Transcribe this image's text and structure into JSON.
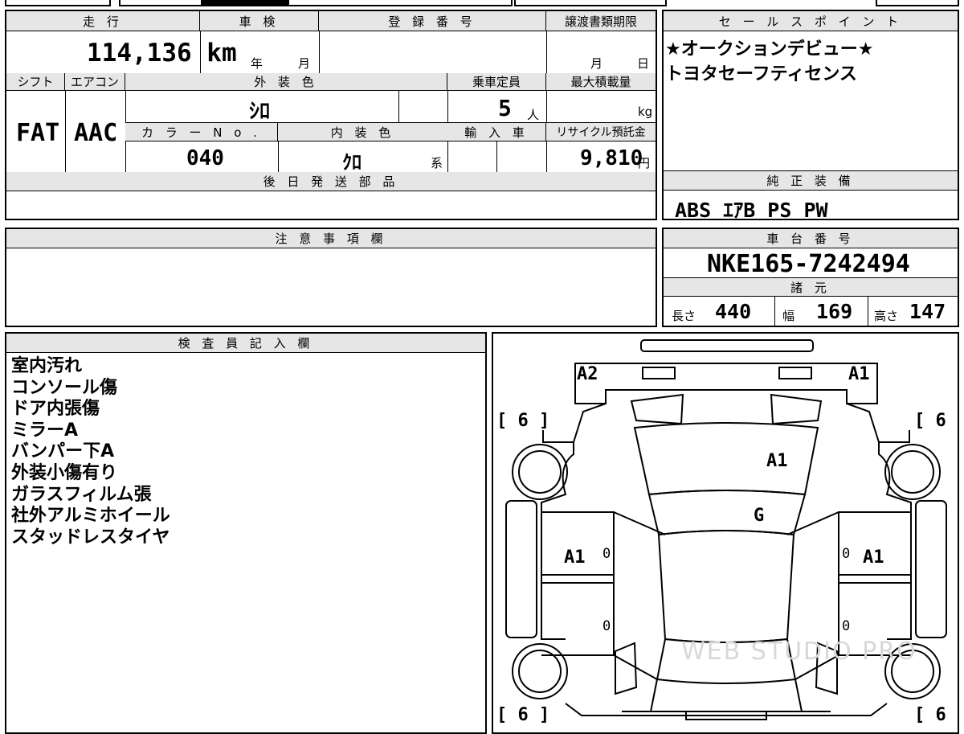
{
  "labels": {
    "mileage": "走 行",
    "inspection": "車 検",
    "registration": "登 録 番 号",
    "transfer_deadline": "譲渡書類期限",
    "sales_point": "セ ー ル ス ポ イ ン ト",
    "shift": "シフト",
    "aircon": "エアコン",
    "exterior_color": "外 装 色",
    "capacity": "乗車定員",
    "max_load": "最大積載量",
    "color_no": "カ ラ ー N o .",
    "interior_color": "内 装 色",
    "import": "輸 入 車",
    "recycle_fee": "リサイクル預託金",
    "later_parts": "後 日 発 送 部 品",
    "standard_equipment": "純 正 装 備",
    "notes": "注 意 事 項 欄",
    "chassis_number": "車 台 番 号",
    "specs": "諸 元",
    "length": "長さ",
    "width": "幅",
    "height": "高さ",
    "inspector_notes": "検 査 員 記 入 欄"
  },
  "units": {
    "year": "年",
    "month": "月",
    "day": "日",
    "person": "人",
    "kg": "kg",
    "yen": "円",
    "interior_suffix": "系"
  },
  "values": {
    "mileage": "114,136 km",
    "shift": "FAT",
    "aircon": "AAC",
    "exterior_color": "ｼﾛ",
    "capacity": "5",
    "color_no": "040",
    "interior_color": "ｸﾛ",
    "recycle_fee": "9,810",
    "standard_equipment": "ABS ｴｱB PS PW",
    "chassis_number": "NKE165-7242494",
    "length": "440",
    "width": "169",
    "height": "147"
  },
  "sales_points": [
    "★オークションデビュー★",
    "トヨタセーフティセンス"
  ],
  "inspector_notes": [
    "室内汚れ",
    "コンソール傷",
    "ドア内張傷",
    "ミラーA",
    "バンパー下A",
    "外装小傷有り",
    "ガラスフィルム張",
    "社外アルミホイール",
    "スタッドレスタイヤ"
  ],
  "diagram": {
    "mirror_left": "A2",
    "mirror_right": "A1",
    "hood": "A1",
    "windshield": "G",
    "door_left": "A1",
    "door_right": "A1",
    "tire_tl": "[ 6 ]",
    "tire_tr": "[ 6 ]",
    "tire_bl": "[ 6 ]",
    "tire_br": "[ 6 ]",
    "zero": "0",
    "watermark": "WEB STUDIO PRO"
  }
}
